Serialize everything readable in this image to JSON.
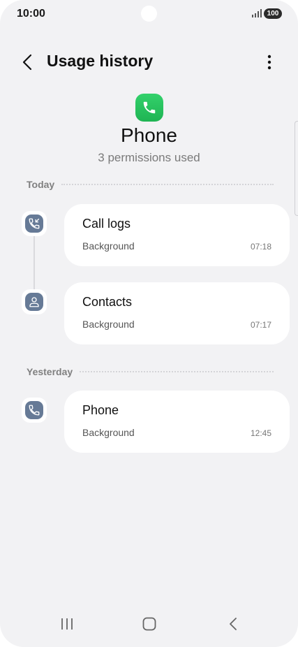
{
  "status_bar": {
    "time": "10:00",
    "battery": "100"
  },
  "app_bar": {
    "title": "Usage history"
  },
  "app": {
    "name": "Phone",
    "permissions_used": "3 permissions used"
  },
  "sections": [
    {
      "label": "Today"
    },
    {
      "label": "Yesterday"
    }
  ],
  "entries": [
    {
      "title": "Call logs",
      "subtitle": "Background",
      "time": "07:18",
      "icon": "call-log-icon"
    },
    {
      "title": "Contacts",
      "subtitle": "Background",
      "time": "07:17",
      "icon": "contacts-icon"
    },
    {
      "title": "Phone",
      "subtitle": "Background",
      "time": "12:45",
      "icon": "phone-icon"
    }
  ],
  "colors": {
    "accent": "#667a96",
    "app_icon": "#22c55e",
    "background": "#f2f2f4"
  }
}
